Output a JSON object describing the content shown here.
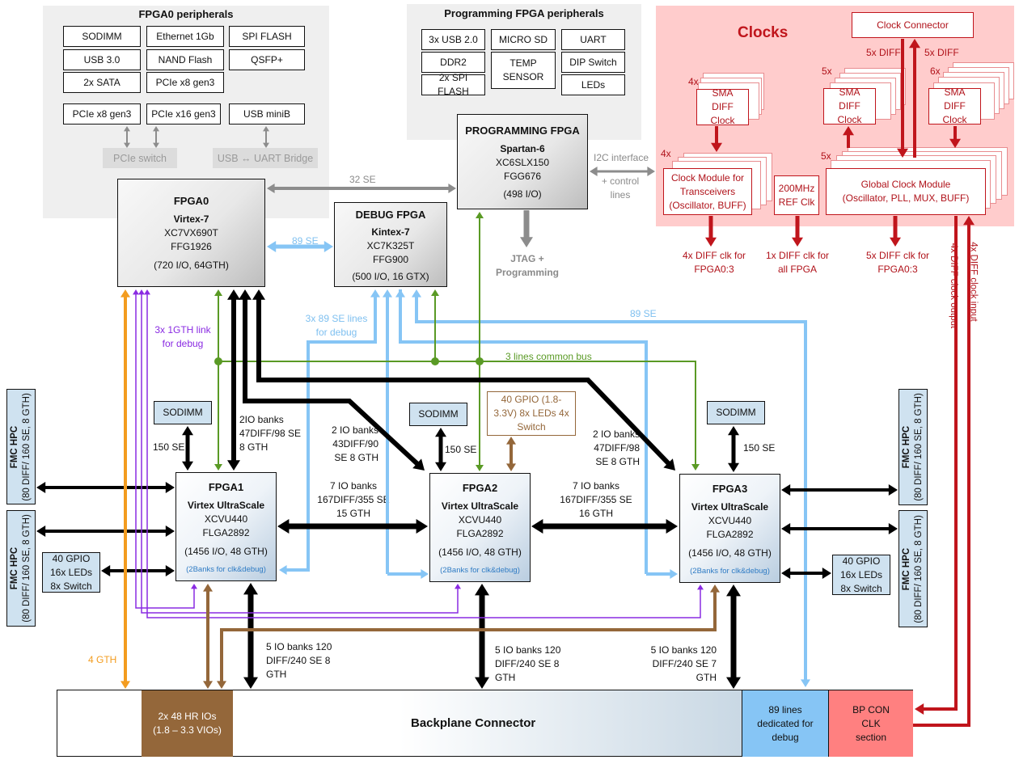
{
  "fpga0_peripherals": {
    "title": "FPGA0 peripherals",
    "items": [
      "SODIMM",
      "Ethernet 1Gb",
      "SPI FLASH",
      "USB 3.0",
      "NAND Flash",
      "QSFP+",
      "2x SATA",
      "PCIe x8 gen3"
    ],
    "lower_items": [
      "PCIe x8 gen3",
      "PCIe x16 gen3",
      "USB miniB"
    ],
    "bridges": [
      "PCIe switch",
      "USB ↔ UART Bridge"
    ]
  },
  "prog_peripherals": {
    "title": "Programming FPGA peripherals",
    "items": [
      "3x USB 2.0",
      "MICRO SD",
      "UART",
      "DDR2",
      "TEMP SENSOR",
      "DIP Switch",
      "2x SPI FLASH",
      "LEDs"
    ]
  },
  "prog_fpga": {
    "title": "PROGRAMMING FPGA",
    "family": "Spartan-6",
    "part": "XC6SLX150",
    "package": "FGG676",
    "io": "(498 I/O)"
  },
  "fpga0": {
    "title": "FPGA0",
    "family": "Virtex-7",
    "part": "XC7VX690T",
    "package": "FFG1926",
    "io": "(720 I/O, 64GTH)"
  },
  "debug_fpga": {
    "title": "DEBUG FPGA",
    "family": "Kintex-7",
    "part": "XC7K325T",
    "package": "FFG900",
    "io": "(500 I/O, 16 GTX)"
  },
  "fpgas": [
    {
      "title": "FPGA1",
      "family": "Virtex UltraScale",
      "part": "XCVU440",
      "package": "FLGA2892",
      "io": "(1456 I/O, 48 GTH)",
      "note": "(2Banks for clk&debug)"
    },
    {
      "title": "FPGA2",
      "family": "Virtex UltraScale",
      "part": "XCVU440",
      "package": "FLGA2892",
      "io": "(1456 I/O, 48 GTH)",
      "note": "(2Banks for clk&debug)"
    },
    {
      "title": "FPGA3",
      "family": "Virtex UltraScale",
      "part": "XCVU440",
      "package": "FLGA2892",
      "io": "(1456 I/O, 48 GTH)",
      "note": "(2Banks for clk&debug)"
    }
  ],
  "clocks": {
    "title": "Clocks",
    "clock_connector": "Clock Connector",
    "sma_label": "SMA DIFF Clock",
    "sma_counts": [
      "4x",
      "5x",
      "6x"
    ],
    "module_transceivers": "Clock Module for Transceivers (Oscillator, BUFF)",
    "module_transceivers_count": "4x",
    "ref_clk": "200MHz REF Clk",
    "global_module": "Global Clock Module (Oscillator, PLL, MUX, BUFF)",
    "global_module_count": "5x",
    "diff_in": "5x DIFF",
    "diff_out": "5x DIFF",
    "out1": "4x DIFF clk for FPGA0:3",
    "out2": "1x DIFF clk for all FPGA",
    "out3": "5x DIFF clk for FPGA0:3",
    "vert_output": "4x DIFF clock output",
    "vert_input": "4x DIFF clock input"
  },
  "links": {
    "se32": "32 SE",
    "i2c": "I2C interface",
    "i2c2": "+ control lines",
    "jtag": "JTAG + Programming",
    "se89": "89 SE",
    "se89_right": "89 SE",
    "debug_lines": "3x 89 SE lines for debug",
    "gth_debug": "3x 1GTH link for debug",
    "common_bus": "3 lines common bus",
    "fpga1_banks": "2IO banks 47DIFF/98 SE 8 GTH",
    "fpga2_banks": "2 IO banks 43DIFF/90 SE 8 GTH",
    "fpga3_banks": "2 IO banks 47DIFF/98 SE 8 GTH",
    "f12": "7 IO banks 167DIFF/355 SE 15 GTH",
    "f23": "7 IO banks 167DIFF/355 SE 16 GTH",
    "bp1": "5 IO banks 120 DIFF/240 SE 8 GTH",
    "bp2": "5 IO banks 120 DIFF/240 SE 8 GTH",
    "bp3": "5 IO banks 120 DIFF/240 SE 7 GTH",
    "gth4": "4 GTH",
    "se150": "150 SE"
  },
  "sodimm": "SODIMM",
  "gpio_left": "40 GPIO 16x LEDs 8x Switch",
  "gpio_right": "40 GPIO 16x LEDs 8x Switch",
  "gpio_mid": "40 GPIO (1.8-3.3V) 8x LEDs 4x Switch",
  "fmc": {
    "title": "FMC HPC",
    "detail": "(80 DIFF/ 160 SE, 8 GTH)"
  },
  "backplane": {
    "hr": "2x 48 HR IOs (1.8 – 3.3 VIOs)",
    "title": "Backplane Connector",
    "debug": "89  lines dedicated for debug",
    "clk": "BP CON CLK section"
  },
  "colors": {
    "black": "#000000",
    "gray": "#8c8c8c",
    "blue": "#86c5f5",
    "green": "#5a9a25",
    "purple": "#8a2be2",
    "orange": "#f39c1f",
    "brown": "#94673a",
    "red": "#c0151c"
  }
}
